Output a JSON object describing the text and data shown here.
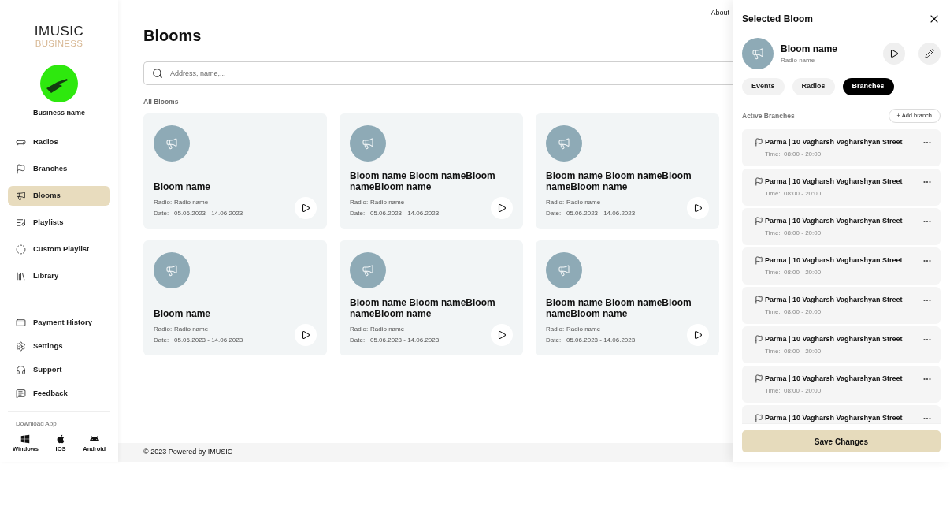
{
  "sidebar": {
    "logo": {
      "wordmark": "IMUSIC",
      "tagline": "BUSINESS"
    },
    "business_name": "Business name",
    "nav_items": [
      {
        "label": "Radios",
        "kind": "radio",
        "selected": false
      },
      {
        "label": "Branches",
        "kind": "flag",
        "selected": false
      },
      {
        "label": "Blooms",
        "kind": "megaphone",
        "selected": true
      },
      {
        "label": "Playlists",
        "kind": "playlist",
        "selected": false
      },
      {
        "label": "Custom Playlist",
        "kind": "custom",
        "selected": false
      },
      {
        "label": "Library",
        "kind": "library",
        "selected": false
      }
    ],
    "account_items": [
      {
        "label": "Payment History",
        "kind": "card",
        "selected": false
      },
      {
        "label": "Settings",
        "kind": "gear",
        "selected": false
      },
      {
        "label": "Support",
        "kind": "headphones",
        "selected": false
      },
      {
        "label": "Feedback",
        "kind": "feedback",
        "selected": false
      }
    ],
    "download": {
      "title": "Download App",
      "platforms": [
        {
          "label": "Windows",
          "kind": "windows"
        },
        {
          "label": "IOS",
          "kind": "apple"
        },
        {
          "label": "Android",
          "kind": "android"
        }
      ]
    }
  },
  "top_nav": {
    "links": [
      "About"
    ]
  },
  "main": {
    "title": "Blooms",
    "search": {
      "placeholder": "Address, name,..."
    },
    "section_title": "All Blooms",
    "cards": [
      {
        "name": "Bloom name",
        "radio_label": "Radio:",
        "radio": "Radio name",
        "date_label": "Date:",
        "date": "05.06.2023 - 14.06.2023"
      },
      {
        "name": "Bloom name Bloom nameBloom nameBloom name",
        "radio_label": "Radio:",
        "radio": "Radio name",
        "date_label": "Date:",
        "date": "05.06.2023 - 14.06.2023"
      },
      {
        "name": "Bloom name Bloom nameBloom nameBloom name",
        "radio_label": "Radio:",
        "radio": "Radio name",
        "date_label": "Date:",
        "date": "05.06.2023 - 14.06.2023"
      },
      {
        "name": "Bloom name",
        "radio_label": "Radio:",
        "radio": "Radio name",
        "date_label": "Date:",
        "date": "05.06.2023 - 14.06.2023"
      },
      {
        "name": "Bloom name Bloom nameBloom nameBloom name",
        "radio_label": "Radio:",
        "radio": "Radio name",
        "date_label": "Date:",
        "date": "05.06.2023 - 14.06.2023"
      },
      {
        "name": "Bloom name Bloom nameBloom nameBloom name",
        "radio_label": "Radio:",
        "radio": "Radio name",
        "date_label": "Date:",
        "date": "05.06.2023 - 14.06.2023"
      }
    ]
  },
  "footer": {
    "text": "© 2023 Powered by IMUSIC"
  },
  "panel": {
    "title": "Selected Bloom",
    "bloom": {
      "name": "Bloom name",
      "radio": "Radio name"
    },
    "tabs": [
      {
        "label": "Events",
        "selected": false
      },
      {
        "label": "Radios",
        "selected": false
      },
      {
        "label": "Branches",
        "selected": true
      }
    ],
    "section_title": "Active Branches",
    "add_button": "+ Add branch",
    "branches": [
      {
        "name": "Parma | 10 Vagharsh Vagharshyan Street",
        "time_label": "Time:",
        "time": "08:00 - 20:00"
      },
      {
        "name": "Parma | 10 Vagharsh Vagharshyan Street",
        "time_label": "Time:",
        "time": "08:00 - 20:00"
      },
      {
        "name": "Parma | 10 Vagharsh Vagharshyan Street",
        "time_label": "Time:",
        "time": "08:00 - 20:00"
      },
      {
        "name": "Parma | 10 Vagharsh Vagharshyan Street",
        "time_label": "Time:",
        "time": "08:00 - 20:00"
      },
      {
        "name": "Parma | 10 Vagharsh Vagharshyan Street",
        "time_label": "Time:",
        "time": "08:00 - 20:00"
      },
      {
        "name": "Parma | 10 Vagharsh Vagharshyan Street",
        "time_label": "Time:",
        "time": "08:00 - 20:00"
      },
      {
        "name": "Parma | 10 Vagharsh Vagharshyan Street",
        "time_label": "Time:",
        "time": "08:00 - 20:00"
      },
      {
        "name": "Parma | 10 Vagharsh Vagharshyan Street"
      }
    ],
    "save_button": "Save Changes"
  }
}
